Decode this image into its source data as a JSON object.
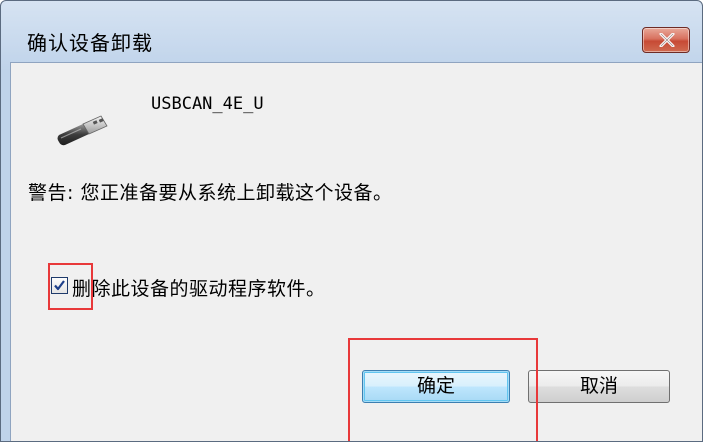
{
  "window": {
    "title": "确认设备卸载"
  },
  "device": {
    "name": "USBCAN_4E_U",
    "icon": "usb-plug-icon"
  },
  "message": {
    "warning": "警告: 您正准备要从系统上卸载这个设备。"
  },
  "options": {
    "delete_driver_label": "删除此设备的驱动程序软件。",
    "delete_driver_checked": true
  },
  "buttons": {
    "ok_label": "确定",
    "cancel_label": "取消"
  },
  "colors": {
    "highlight": "#e8383a",
    "close_button": "#c74a35",
    "default_button_border": "#3c7fb1"
  }
}
